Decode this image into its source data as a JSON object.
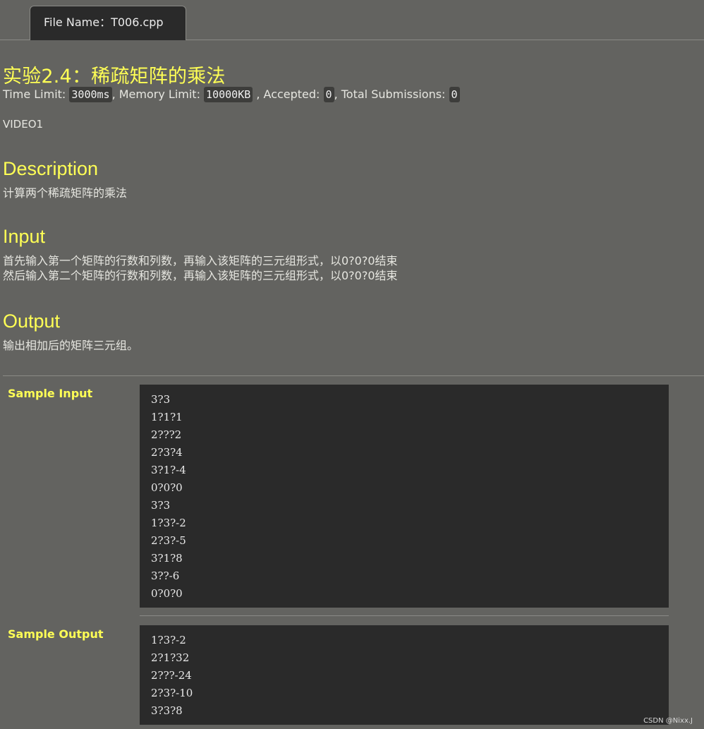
{
  "tab": {
    "label": "File Name：T006.cpp"
  },
  "problem": {
    "title": "实验2.4：稀疏矩阵的乘法",
    "time_limit_label": "Time Limit: ",
    "time_limit": "3000ms",
    "memory_limit_label": ", Memory Limit: ",
    "memory_limit": "10000KB",
    "accepted_label": " , Accepted: ",
    "accepted": "0",
    "total_label": ", Total Submissions: ",
    "total": "0",
    "video": "VIDEO1"
  },
  "description": {
    "heading": "Description",
    "text": "计算两个稀疏矩阵的乘法"
  },
  "input": {
    "heading": "Input",
    "lines": [
      "首先输入第一个矩阵的行数和列数，再输入该矩阵的三元组形式，以0?0?0结束",
      "然后输入第二个矩阵的行数和列数，再输入该矩阵的三元组形式，以0?0?0结束"
    ]
  },
  "output": {
    "heading": "Output",
    "text": "输出相加后的矩阵三元组。"
  },
  "sample_input": {
    "label": "Sample Input",
    "lines": [
      "3?3",
      "1?1?1",
      "2???2",
      "2?3?4",
      "3?1?-4",
      "0?0?0",
      "3?3",
      "1?3?-2",
      "2?3?-5",
      "3?1?8",
      "3??-6",
      "0?0?0"
    ]
  },
  "sample_output": {
    "label": "Sample Output",
    "lines": [
      "1?3?-2",
      "2?1?32",
      "2???-24",
      "2?3?-10",
      "3?3?8"
    ]
  },
  "watermark": "CSDN @Nixx.J"
}
